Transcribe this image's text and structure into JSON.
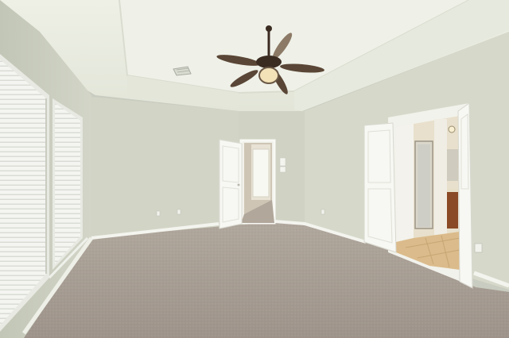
{
  "scene": {
    "description_visible_text": "",
    "colors": {
      "ceiling": "#eceee4",
      "ceiling_tray": "#e4e7da",
      "wall_left": "#cfd2c4",
      "wall_back": "#d3d6c8",
      "wall_right": "#d7dacb",
      "carpet": "#a59c93",
      "trim": "#f4f4ef",
      "door": "#f7f7f3",
      "window_blind": "#f2f3ef",
      "tile_floor": "#d9b98c",
      "fan_blade": "#5a4636",
      "fan_light": "#f3e2b8",
      "cabinet": "#8a4a25"
    },
    "objects": [
      "ceiling-fan",
      "window-blinds-left",
      "window-blinds-right",
      "door-center",
      "hallway",
      "double-door-right",
      "bathroom",
      "carpet-floor",
      "air-vent",
      "light-switch"
    ]
  }
}
